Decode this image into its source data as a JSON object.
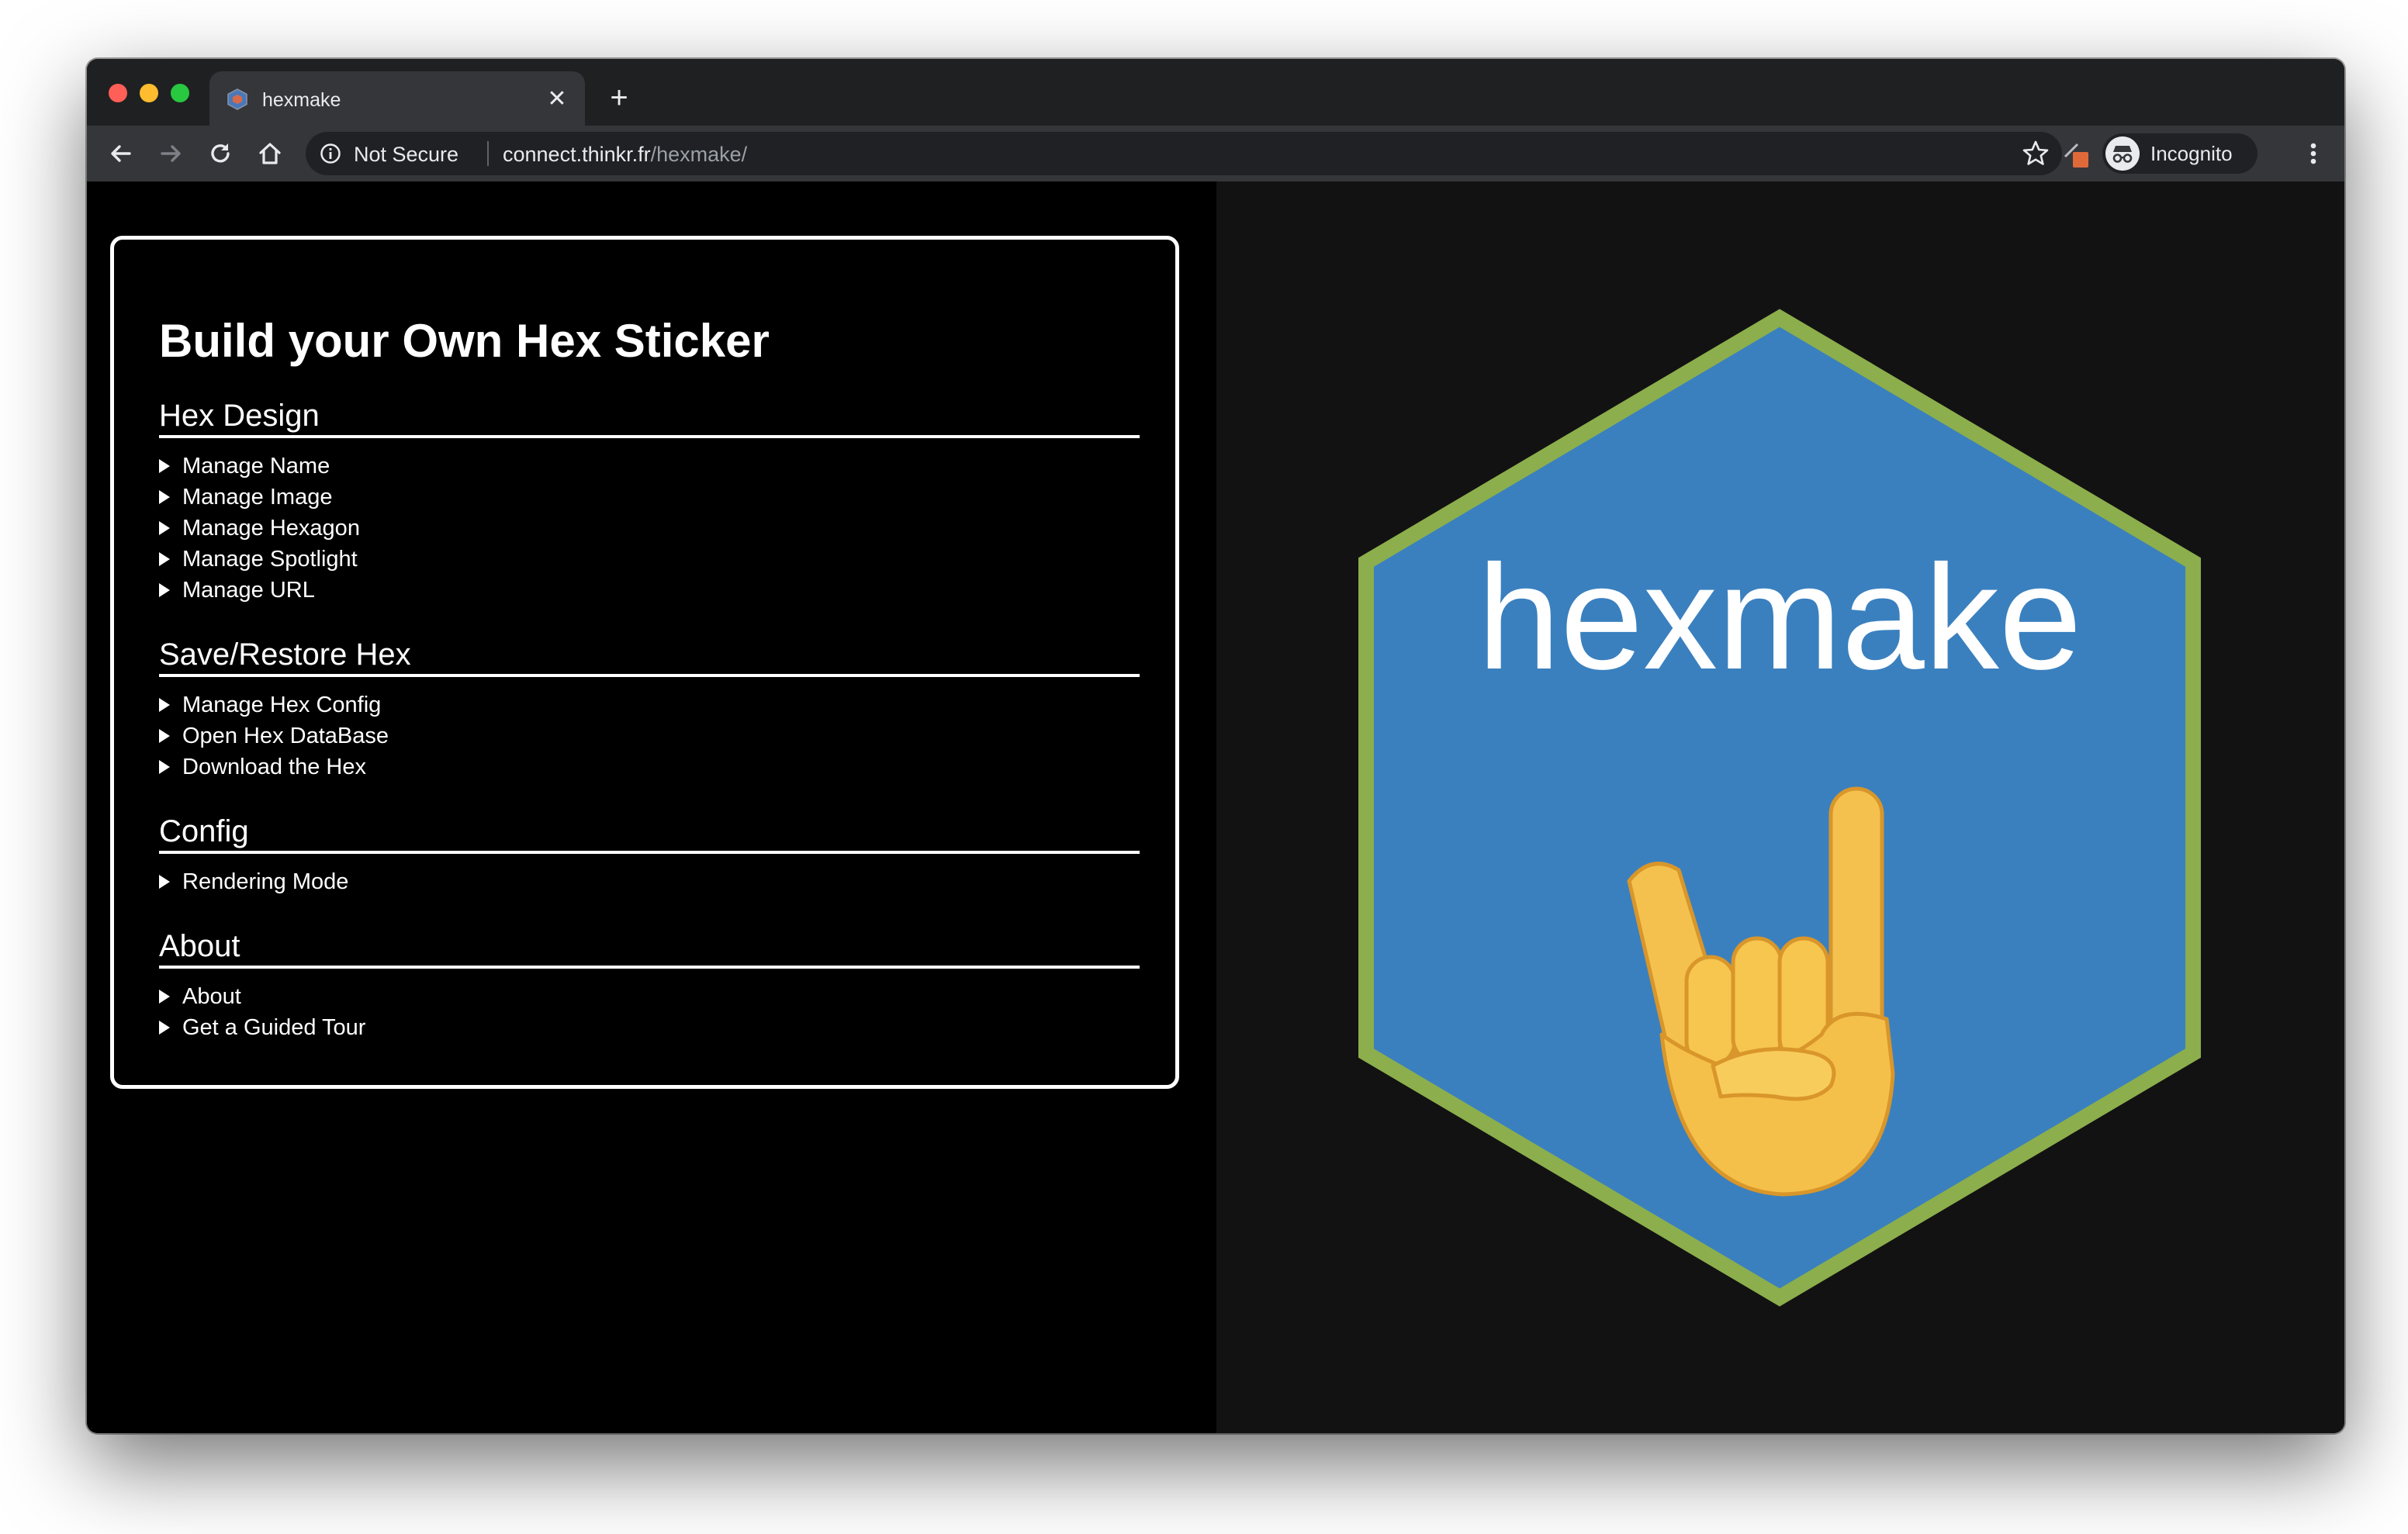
{
  "browser": {
    "tab_title": "hexmake",
    "tab_close": "✕",
    "new_tab": "+",
    "security_label": "Not Secure",
    "url_host": "connect.thinkr.fr",
    "url_path": "/hexmake/",
    "profile_label": "Incognito"
  },
  "panel": {
    "title": "Build your Own Hex Sticker",
    "sections": [
      {
        "heading": "Hex Design",
        "items": [
          "Manage Name",
          "Manage Image",
          "Manage Hexagon",
          "Manage Spotlight",
          "Manage URL"
        ]
      },
      {
        "heading": "Save/Restore Hex",
        "items": [
          "Manage Hex Config",
          "Open Hex DataBase",
          "Download the Hex"
        ]
      },
      {
        "heading": "Config",
        "items": [
          "Rendering Mode"
        ]
      },
      {
        "heading": "About",
        "items": [
          "About",
          "Get a Guided Tour"
        ]
      }
    ]
  },
  "sticker": {
    "name": "hexmake",
    "emoji": "🤘",
    "fill_color": "#3a80bf",
    "border_color": "#8cae4c",
    "text_color": "#ffffff"
  }
}
